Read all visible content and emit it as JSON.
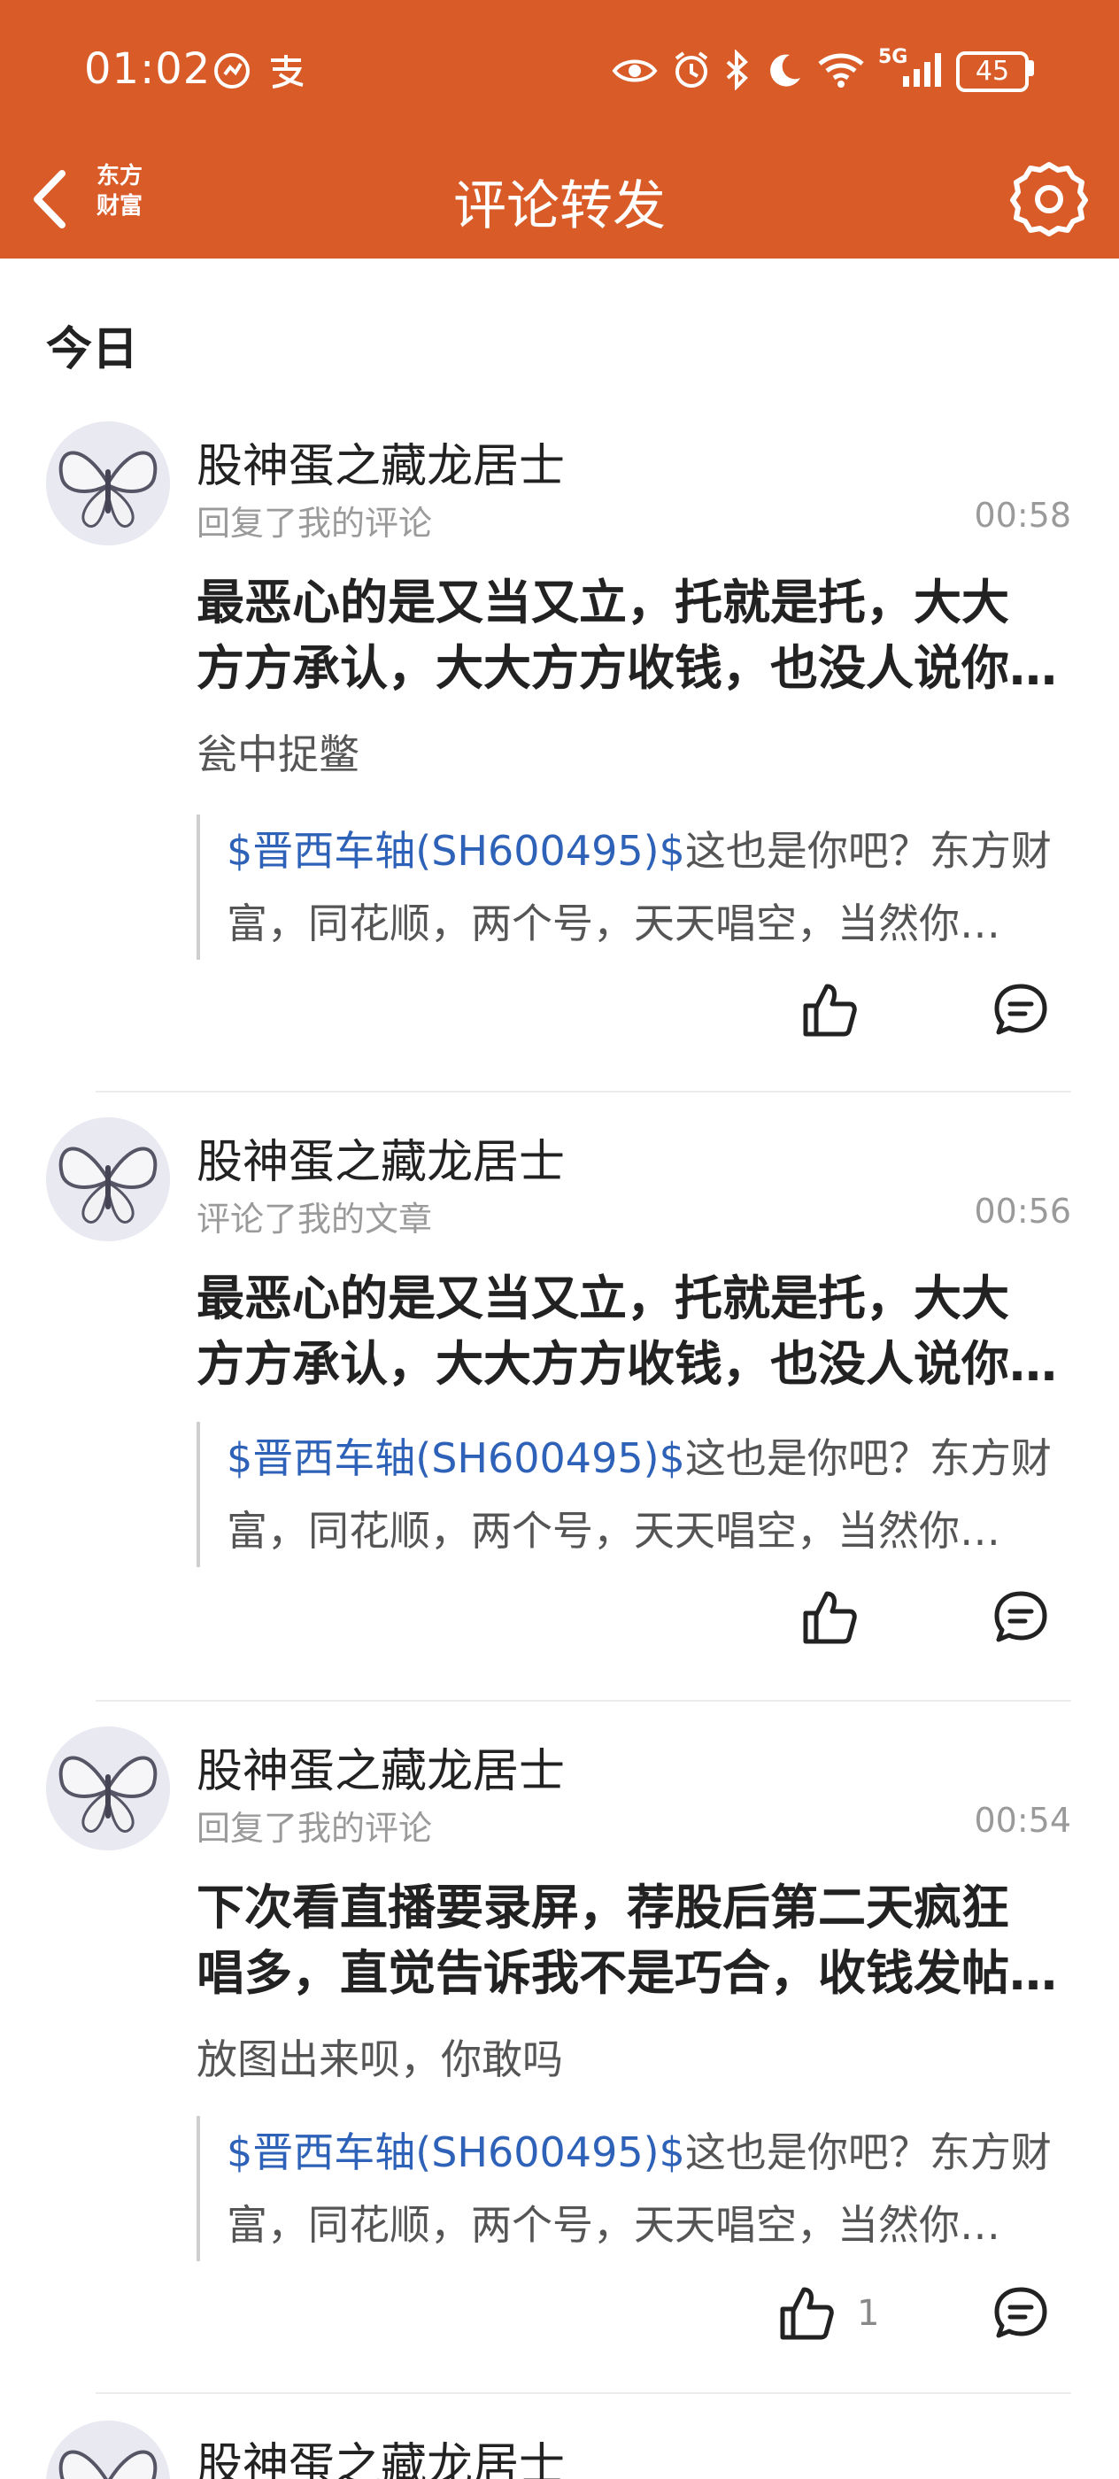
{
  "status_bar": {
    "time": "01:02",
    "network": "5G",
    "battery": "45"
  },
  "nav": {
    "logo_line1": "东方",
    "logo_line2": "财富",
    "title": "评论转发"
  },
  "section_title": "今日",
  "items": [
    {
      "name": "股神蛋之藏龙居士",
      "action": "回复了我的评论",
      "time": "00:58",
      "content_line1": "最恶心的是又当又立，托就是托，大大",
      "content_line2": "方方承认，大大方方收钱，也没人说你…",
      "reply": "瓮中捉鳖",
      "quote_stock": "$晋西车轴(SH600495)$",
      "quote_line1": "这也是你吧？东方财",
      "quote_line2": "富，同花顺，两个号，天天唱空，当然你…",
      "like_count": ""
    },
    {
      "name": "股神蛋之藏龙居士",
      "action": "评论了我的文章",
      "time": "00:56",
      "content_line1": "最恶心的是又当又立，托就是托，大大",
      "content_line2": "方方承认，大大方方收钱，也没人说你…",
      "reply": "",
      "quote_stock": "$晋西车轴(SH600495)$",
      "quote_line1": "这也是你吧？东方财",
      "quote_line2": "富，同花顺，两个号，天天唱空，当然你…",
      "like_count": ""
    },
    {
      "name": "股神蛋之藏龙居士",
      "action": "回复了我的评论",
      "time": "00:54",
      "content_line1": "下次看直播要录屏，荐股后第二天疯狂",
      "content_line2": "唱多，直觉告诉我不是巧合，收钱发帖…",
      "reply": "放图出来呗，你敢吗",
      "quote_stock": "$晋西车轴(SH600495)$",
      "quote_line1": "这也是你吧？东方财",
      "quote_line2": "富，同花顺，两个号，天天唱空，当然你…",
      "like_count": "1"
    },
    {
      "name": "股神蛋之藏龙居士"
    }
  ],
  "colors": {
    "brand": "#d95c28",
    "link": "#2e62b8"
  },
  "icons": [
    "back-icon",
    "gear-icon",
    "like-icon",
    "comment-icon",
    "eye-icon",
    "alarm-icon",
    "bluetooth-icon",
    "moon-icon",
    "wifi-icon",
    "signal-icon"
  ]
}
